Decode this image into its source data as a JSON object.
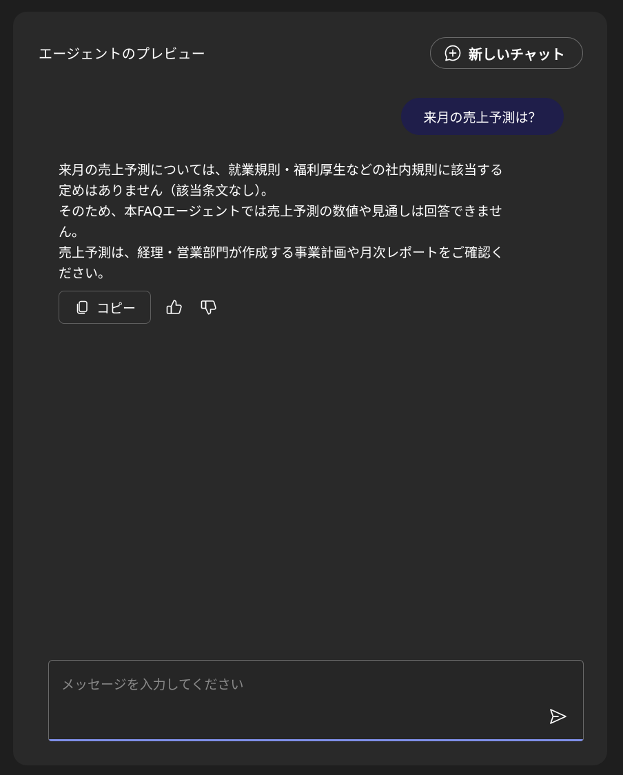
{
  "header": {
    "title": "エージェントのプレビュー",
    "new_chat_label": "新しいチャット"
  },
  "conversation": {
    "user_message": "来月の売上予測は？",
    "bot_message_lines": [
      "来月の売上予測については、就業規則・福利厚生などの社内規則に該当する",
      "定めはありません（該当条文なし）。",
      "そのため、本FAQエージェントでは売上予測の数値や見通しは回答できませ",
      "ん。",
      "売上予測は、経理・営業部門が作成する事業計画や月次レポートをご確認く",
      "ださい。"
    ],
    "actions": {
      "copy_label": "コピー"
    }
  },
  "composer": {
    "placeholder": "メッセージを入力してください",
    "value": ""
  },
  "icons": {
    "new_chat": "chat-add-icon",
    "copy": "copy-icon",
    "thumbs_up": "thumbs-up-icon",
    "thumbs_down": "thumbs-down-icon",
    "send": "send-icon"
  },
  "colors": {
    "background": "#1e1e1e",
    "panel": "#292929",
    "user_bubble": "#1f1e4a",
    "accent_underline": "#7f8fe8",
    "text": "#ffffff",
    "placeholder": "#8a8a8a"
  }
}
